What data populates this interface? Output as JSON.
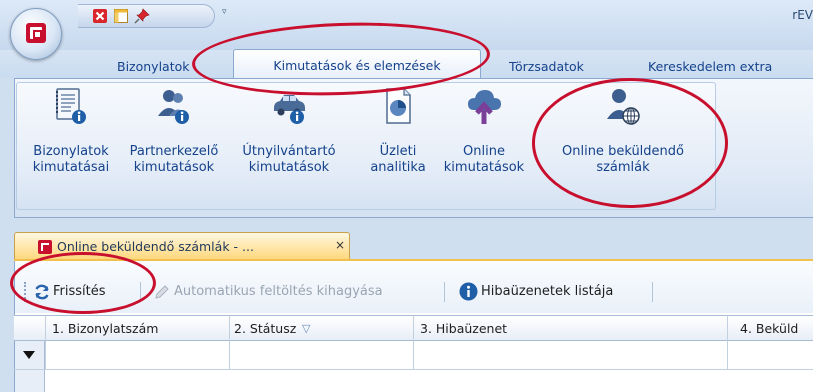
{
  "app": {
    "title_fragment": "rEV"
  },
  "quick_access": {
    "dropdown_glyph": "▿"
  },
  "ribbon_tabs": [
    {
      "label": "Bizonylatok"
    },
    {
      "label": "Kimutatások és elemzések"
    },
    {
      "label": "Törzsadatok"
    },
    {
      "label": "Kereskedelem extra"
    }
  ],
  "ribbon_buttons": [
    {
      "line1": "Bizonylatok",
      "line2": "kimutatásai",
      "icon": "document-info-icon"
    },
    {
      "line1": "Partnerkezelő",
      "line2": "kimutatások",
      "icon": "users-info-icon"
    },
    {
      "line1": "Útnyilvántartó",
      "line2": "kimutatások",
      "icon": "car-info-icon"
    },
    {
      "line1": "Üzleti",
      "line2": "analitika",
      "icon": "pie-chart-icon"
    },
    {
      "line1": "Online",
      "line2": "kimutatások",
      "icon": "cloud-upload-icon"
    },
    {
      "line1": "Online beküldendő",
      "line2": "számlák",
      "icon": "user-globe-icon"
    }
  ],
  "document_tab": {
    "label": "Online beküldendő számlák - ...",
    "close_glyph": "×"
  },
  "toolbar": {
    "refresh_label": "Frissítés",
    "skip_upload_label": "Automatikus feltöltés kihagyása",
    "error_list_label": "Hibaüzenetek listája"
  },
  "grid": {
    "columns": [
      {
        "label": "1. Bizonylatszám"
      },
      {
        "label": "2. Státusz"
      },
      {
        "label": "3. Hibaüzenet"
      },
      {
        "label": "4. Beküld"
      }
    ],
    "filter_glyph": "▽"
  },
  "colors": {
    "annotation_red": "#c8102e",
    "accent_blue": "#15428b",
    "active_doc_tab": "#ffd77a"
  }
}
